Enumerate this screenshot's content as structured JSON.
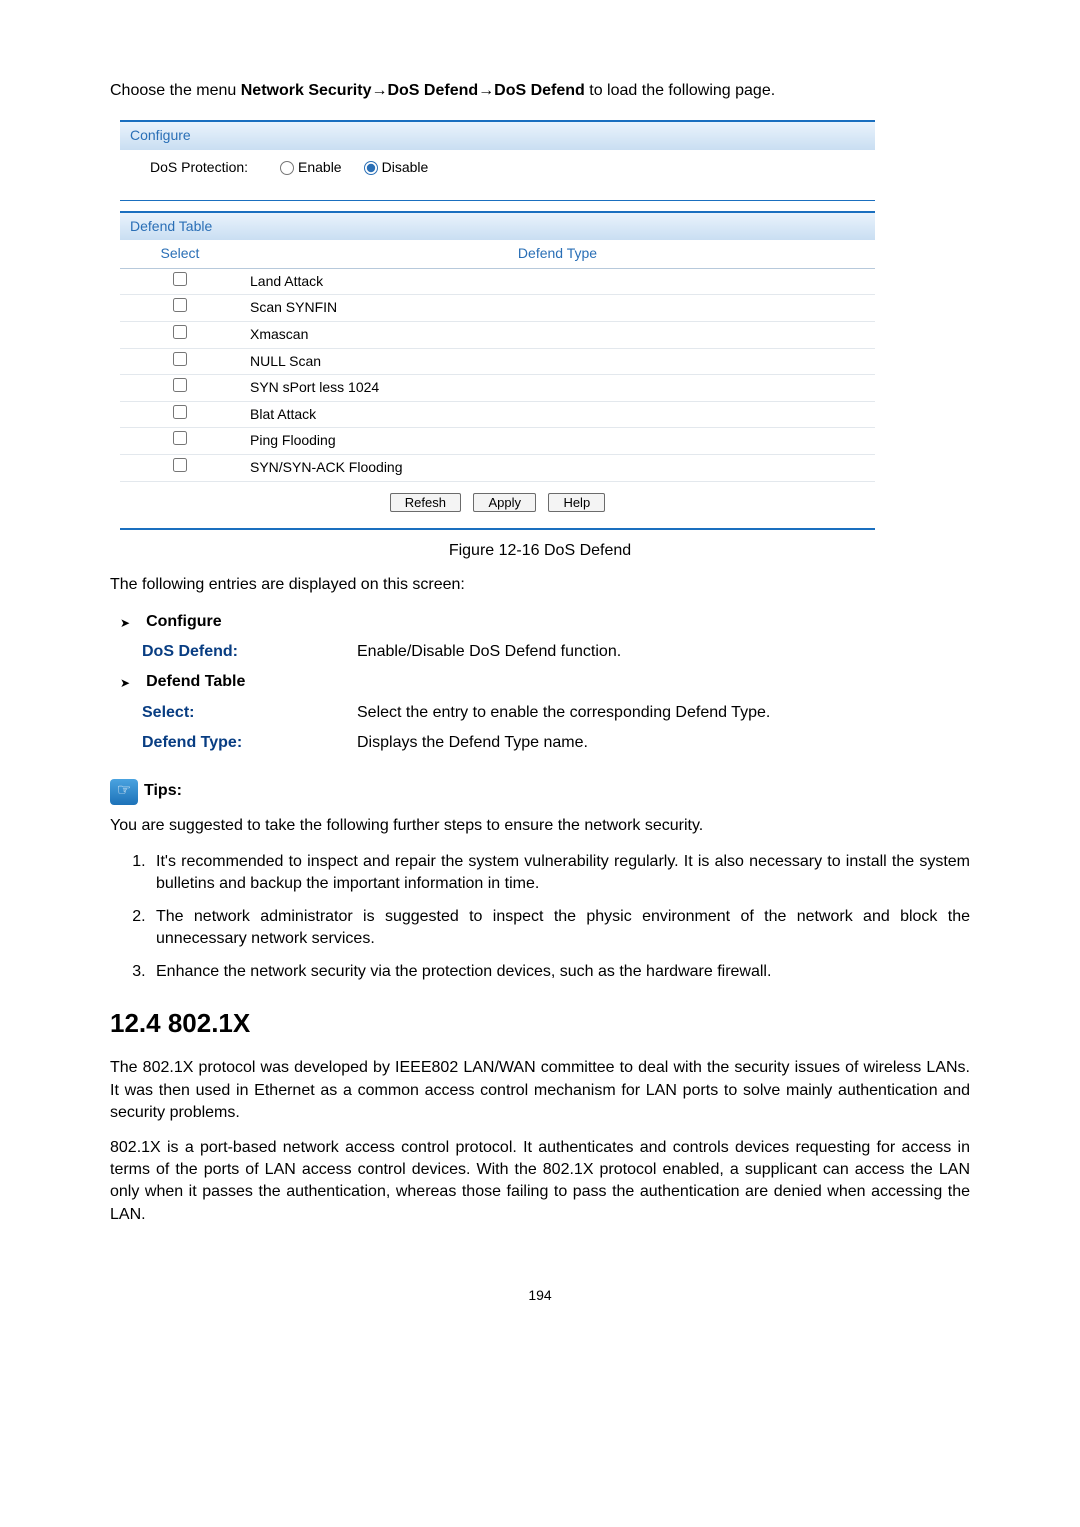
{
  "intro": {
    "prefix": "Choose the menu ",
    "path": "Network Security→DoS Defend→DoS Defend",
    "suffix": " to load the following page."
  },
  "panel1": {
    "title": "Configure",
    "label": "DoS Protection:",
    "enable": "Enable",
    "disable": "Disable"
  },
  "panel2": {
    "title": "Defend Table",
    "col_select": "Select",
    "col_type": "Defend Type",
    "rows": [
      "Land Attack",
      "Scan SYNFIN",
      "Xmascan",
      "NULL Scan",
      "SYN sPort less 1024",
      "Blat Attack",
      "Ping Flooding",
      "SYN/SYN-ACK Flooding"
    ],
    "buttons": {
      "refresh": "Refesh",
      "apply": "Apply",
      "help": "Help"
    }
  },
  "caption": "Figure 12-16 DoS Defend",
  "entries_intro": "The following entries are displayed on this screen:",
  "configure_section": {
    "heading": "Configure",
    "rows": [
      {
        "label": "DoS Defend:",
        "value": "Enable/Disable DoS Defend function."
      }
    ]
  },
  "defend_section": {
    "heading": "Defend Table",
    "rows": [
      {
        "label": "Select:",
        "value": "Select the entry to enable the corresponding Defend Type."
      },
      {
        "label": "Defend Type:",
        "value": "Displays the Defend Type name."
      }
    ]
  },
  "tips": {
    "title": "Tips:",
    "intro": "You are suggested to take the following further steps to ensure the network security.",
    "items": [
      "It's recommended to inspect and repair the system vulnerability regularly. It is also necessary to install the system bulletins and backup the important information in time.",
      "The network administrator is suggested to inspect the physic environment of the network and block the unnecessary network services.",
      "Enhance the network security via the protection devices, such as the hardware firewall."
    ]
  },
  "section": {
    "heading": "12.4 802.1X",
    "p1": "The 802.1X protocol was developed by IEEE802 LAN/WAN committee to deal with the security issues of wireless LANs. It was then used in Ethernet as a common access control mechanism for LAN ports to solve mainly authentication and security problems.",
    "p2": "802.1X is a port-based network access control protocol. It authenticates and controls devices requesting for access in terms of the ports of LAN access control devices. With the 802.1X protocol enabled, a supplicant can access the LAN only when it passes the authentication, whereas those failing to pass the authentication are denied when accessing the LAN."
  },
  "page": "194"
}
